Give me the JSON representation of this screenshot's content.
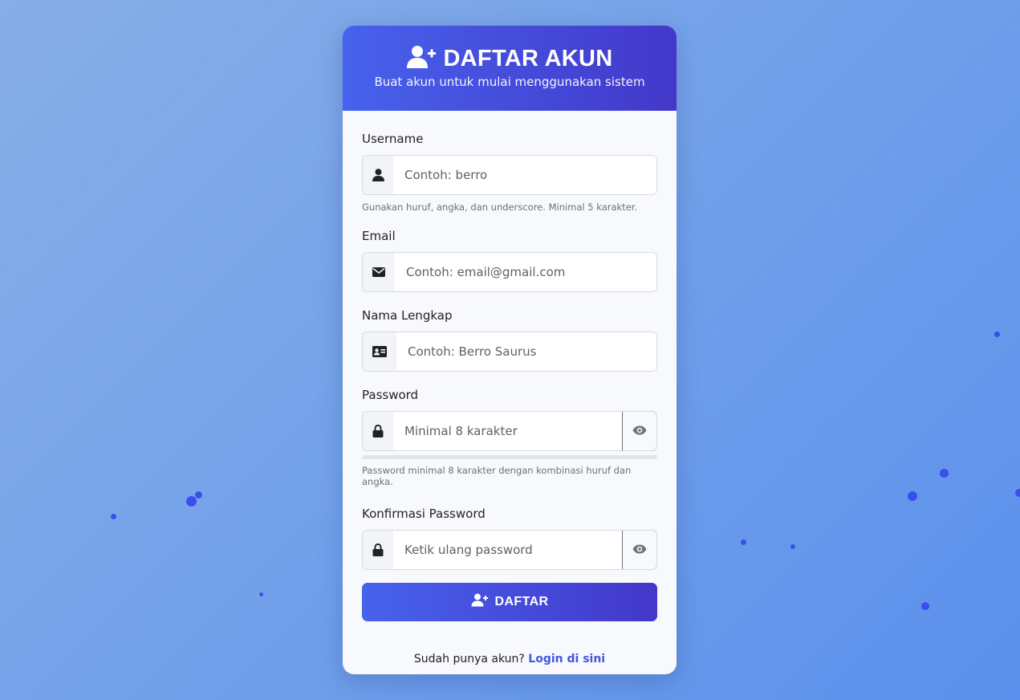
{
  "header": {
    "title": "DAFTAR AKUN",
    "subtitle": "Buat akun untuk mulai menggunakan sistem",
    "icon": "user-plus-icon"
  },
  "fields": {
    "username": {
      "label": "Username",
      "placeholder": "Contoh: berro",
      "value": "",
      "icon": "user-icon",
      "hint": "Gunakan huruf, angka, dan underscore. Minimal 5 karakter."
    },
    "email": {
      "label": "Email",
      "placeholder": "Contoh: email@gmail.com",
      "value": "",
      "icon": "envelope-icon"
    },
    "fullname": {
      "label": "Nama Lengkap",
      "placeholder": "Contoh: Berro Saurus",
      "value": "",
      "icon": "id-card-icon"
    },
    "password": {
      "label": "Password",
      "placeholder": "Minimal 8 karakter",
      "value": "",
      "icon": "lock-icon",
      "toggle_icon": "eye-icon",
      "strength": 0,
      "hint": "Password minimal 8 karakter dengan kombinasi huruf dan angka."
    },
    "confirm_password": {
      "label": "Konfirmasi Password",
      "placeholder": "Ketik ulang password",
      "value": "",
      "icon": "lock-icon",
      "toggle_icon": "eye-icon"
    }
  },
  "submit": {
    "label": "DAFTAR",
    "icon": "user-plus-icon"
  },
  "footer": {
    "text": "Sudah punya akun?",
    "link_label": "Login di sini"
  },
  "colors": {
    "accent_start": "#4762ec",
    "accent_end": "#4338ca",
    "link": "#4157e0",
    "background_start": "#87aee6",
    "background_end": "#5b90ec",
    "dot": "#3b4fe8"
  }
}
